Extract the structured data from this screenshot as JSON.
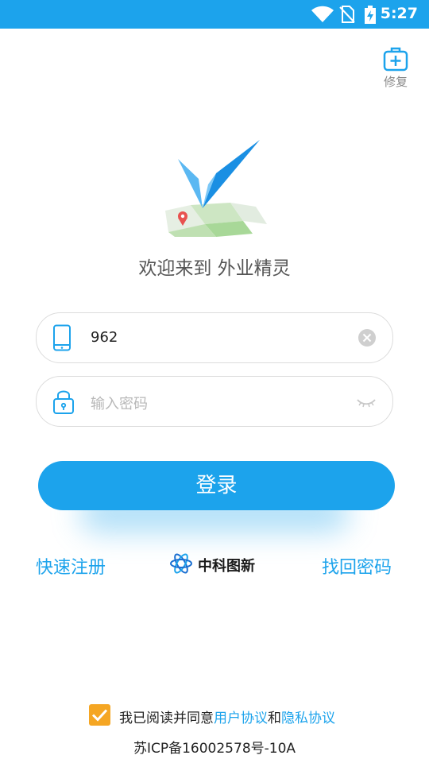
{
  "status_bar": {
    "time": "5:27"
  },
  "repair": {
    "label": "修复"
  },
  "welcome": {
    "text": "欢迎来到 外业精灵"
  },
  "phone_field": {
    "value": "962"
  },
  "password_field": {
    "placeholder": "输入密码"
  },
  "login_button": {
    "label": "登录"
  },
  "links": {
    "register": "快速注册",
    "forgot": "找回密码"
  },
  "brand": {
    "name": "中科图新"
  },
  "agreement": {
    "prefix": "我已阅读并同意",
    "user_agreement": "用户协议",
    "and": "和",
    "privacy_agreement": "隐私协议",
    "checked": true
  },
  "icp": {
    "text": "苏ICP备16002578号-10A"
  },
  "colors": {
    "primary": "#1ca3ec",
    "checkbox": "#f5a623",
    "text": "#222222"
  }
}
